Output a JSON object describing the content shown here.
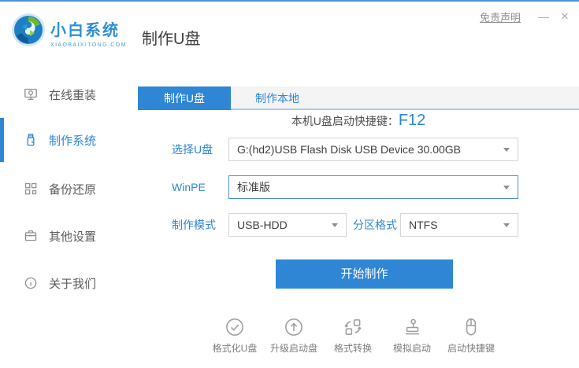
{
  "window": {
    "disclaimer": "免责声明",
    "minimize_glyph": "—",
    "close_glyph": "×"
  },
  "brand": {
    "name": "小白系统",
    "domain": "XIAOBAIXITONG.COM"
  },
  "header": {
    "page_title": "制作U盘"
  },
  "sidebar": {
    "items": [
      {
        "label": "在线重装",
        "icon": "online-reinstall-icon",
        "active": false
      },
      {
        "label": "制作系统",
        "icon": "usb-drive-icon",
        "active": true
      },
      {
        "label": "备份还原",
        "icon": "backup-restore-icon",
        "active": false
      },
      {
        "label": "其他设置",
        "icon": "settings-toolbox-icon",
        "active": false
      },
      {
        "label": "关于我们",
        "icon": "info-icon",
        "active": false
      }
    ]
  },
  "tabs": [
    {
      "label": "制作U盘",
      "active": true
    },
    {
      "label": "制作本地",
      "active": false
    }
  ],
  "content": {
    "hotkey_label": "本机U盘启动快捷键：",
    "hotkey_value": "F12",
    "fields": {
      "usb": {
        "label": "选择U盘",
        "value": "G:(hd2)USB Flash Disk USB Device 30.00GB"
      },
      "winpe": {
        "label": "WinPE",
        "value": "标准版"
      },
      "mode": {
        "label": "制作模式",
        "value": "USB-HDD"
      },
      "partition": {
        "label": "分区格式",
        "value": "NTFS"
      }
    },
    "start_button": "开始制作"
  },
  "toolbar": {
    "items": [
      {
        "label": "格式化U盘",
        "icon": "format-usb-icon"
      },
      {
        "label": "升级启动盘",
        "icon": "upgrade-bootdisk-icon"
      },
      {
        "label": "格式转换",
        "icon": "format-convert-icon"
      },
      {
        "label": "模拟启动",
        "icon": "simulate-boot-icon"
      },
      {
        "label": "启动快捷键",
        "icon": "boot-hotkey-icon"
      }
    ]
  },
  "colors": {
    "accent": "#2e86d5",
    "tab_underline": "#a8cbea",
    "border": "#d5d5d5",
    "focused_border": "#4b8fd4",
    "text_dark": "#404040",
    "text_gray": "#5c5c5c",
    "icon_gray": "#9c9c9c"
  }
}
